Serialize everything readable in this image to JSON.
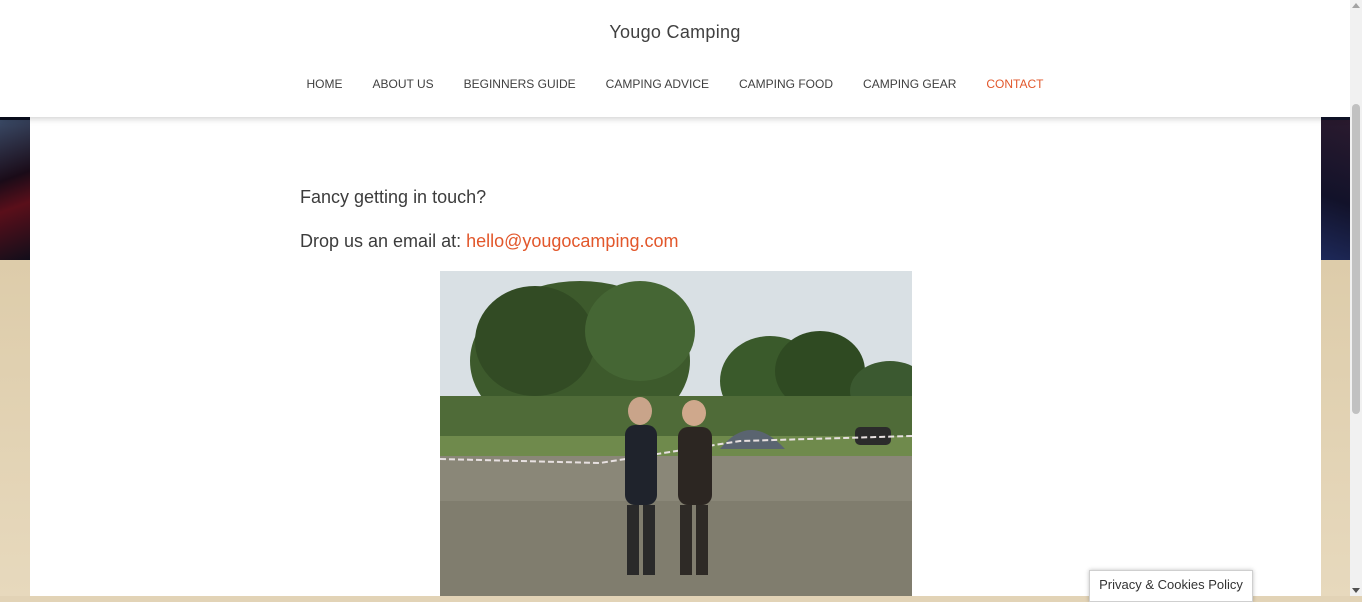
{
  "site": {
    "title": "Yougo Camping"
  },
  "nav": {
    "items": [
      {
        "label": "HOME"
      },
      {
        "label": "ABOUT US"
      },
      {
        "label": "BEGINNERS GUIDE"
      },
      {
        "label": "CAMPING ADVICE"
      },
      {
        "label": "CAMPING FOOD"
      },
      {
        "label": "CAMPING GEAR"
      },
      {
        "label": "CONTACT",
        "active": true
      }
    ]
  },
  "content": {
    "intro": "Fancy getting in touch?",
    "email_prefix": "Drop us an email at: ",
    "email": "hello@yougocamping.com"
  },
  "privacy": {
    "label": "Privacy & Cookies Policy"
  },
  "colors": {
    "accent": "#e2572b",
    "text": "#3c3c3c",
    "sand": "#e2d3b6"
  }
}
